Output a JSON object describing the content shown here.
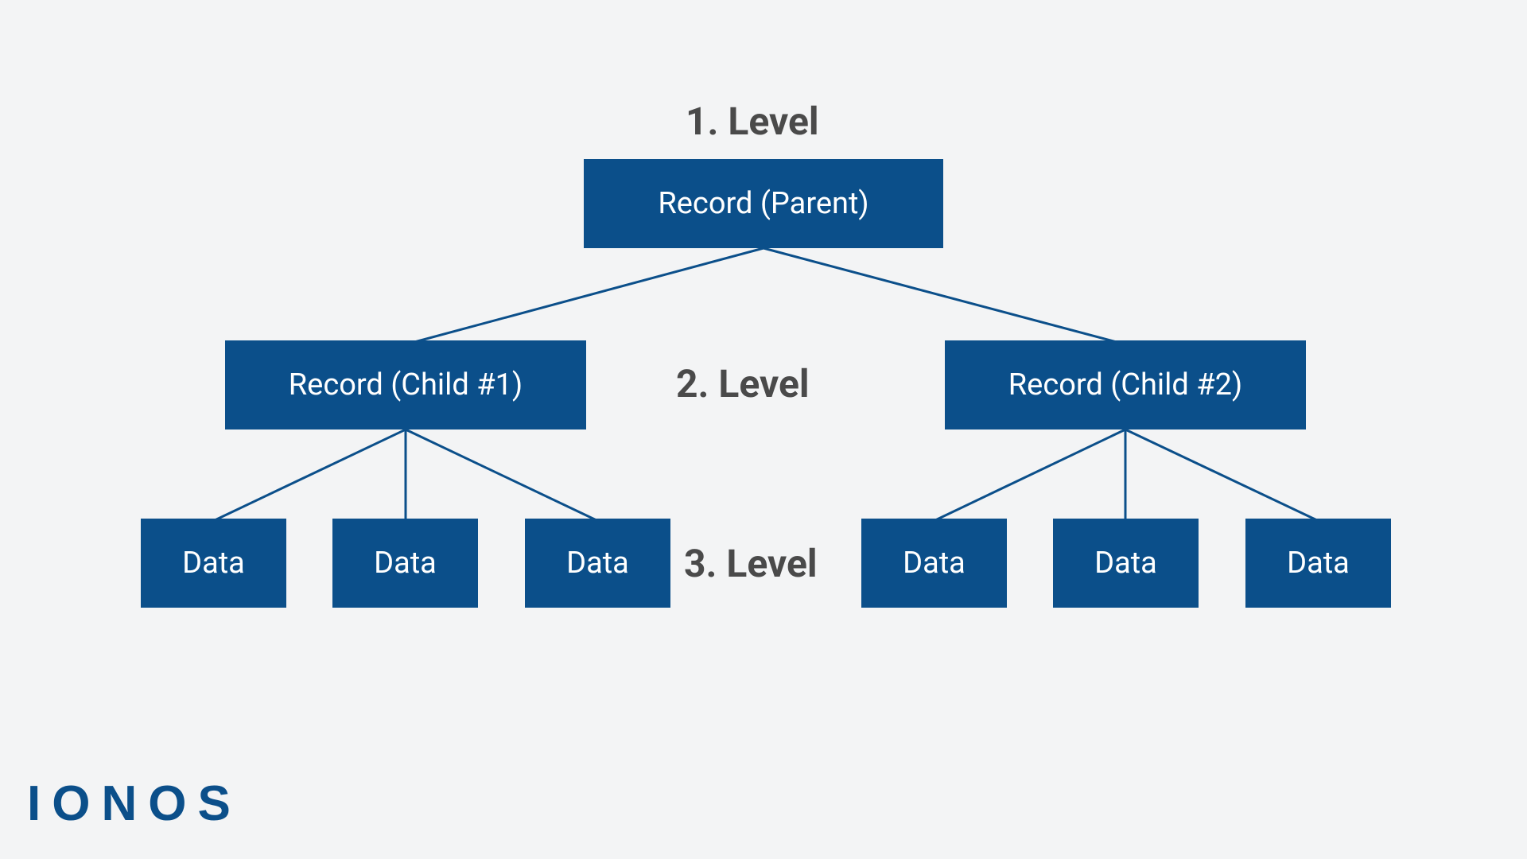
{
  "labels": {
    "level1": "1. Level",
    "level2": "2. Level",
    "level3": "3. Level"
  },
  "nodes": {
    "parent": "Record (Parent)",
    "child1": "Record (Child #1)",
    "child2": "Record (Child #2)",
    "data1": "Data",
    "data2": "Data",
    "data3": "Data",
    "data4": "Data",
    "data5": "Data",
    "data6": "Data"
  },
  "brand": "IONOS",
  "colors": {
    "box": "#0b4f8a",
    "text": "#4a4a4a",
    "bg": "#f3f4f5"
  }
}
